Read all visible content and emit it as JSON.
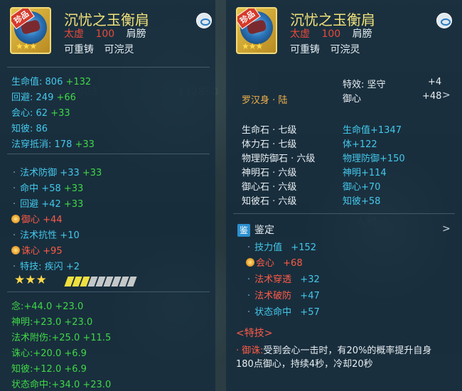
{
  "left": {
    "item": {
      "badge": "珍品",
      "name": "沉忧之玉衡肩",
      "tier": "太虚",
      "level": "100",
      "slot": "肩膀",
      "flags": [
        "可重铸",
        "可浣灵"
      ],
      "stars": "★★★"
    },
    "base_stats": [
      {
        "label": "生命值:",
        "value": "806",
        "bonus": "+132"
      },
      {
        "label": "回避:",
        "value": "249",
        "bonus": "+66"
      },
      {
        "label": "会心:",
        "value": "62",
        "bonus": "+33"
      },
      {
        "label": "知彼:",
        "value": "86",
        "bonus": ""
      },
      {
        "label": "法穿抵消:",
        "value": "178",
        "bonus": "+33"
      }
    ],
    "affixes": [
      {
        "label": "法术防御",
        "value": "+33",
        "bonus": "+33",
        "special": false
      },
      {
        "label": "命中",
        "value": "+58",
        "bonus": "+33",
        "special": false
      },
      {
        "label": "回避",
        "value": "+42",
        "bonus": "+33",
        "special": false
      },
      {
        "label": "御心",
        "value": "+44",
        "bonus": "",
        "special": true
      },
      {
        "label": "法术抗性",
        "value": "+10",
        "bonus": "",
        "special": false
      },
      {
        "label": "诛心",
        "value": "+95",
        "bonus": "",
        "special": true
      },
      {
        "label": "特技:",
        "value": "疾闪",
        "bonus": "+2",
        "special": false
      }
    ],
    "rating_stars": "★★★",
    "enhance_level": 0.33,
    "attrs": [
      {
        "label": "念:",
        "value": "+44.0",
        "bonus": "+23.0"
      },
      {
        "label": "神明:",
        "value": "+23.0",
        "bonus": "+23.0"
      },
      {
        "label": "法术附伤:",
        "value": "+25.0",
        "bonus": "+11.5"
      },
      {
        "label": "诛心:",
        "value": "+20.0",
        "bonus": "+6.9"
      },
      {
        "label": "知彼:",
        "value": "+12.0",
        "bonus": "+6.9"
      },
      {
        "label": "状态命中:",
        "value": "+34.0",
        "bonus": "+23.0"
      }
    ]
  },
  "right": {
    "item": {
      "badge": "珍品",
      "name": "沉忧之玉衡肩",
      "tier": "太虚",
      "level": "100",
      "slot": "肩膀",
      "flags": [
        "可重铸",
        "可浣灵"
      ],
      "stars": "★★★"
    },
    "effect": {
      "label": "特效: 坚守",
      "value": "+4"
    },
    "yuxin": {
      "label": "御心",
      "value": "+48",
      "chevron": ">"
    },
    "set_name": "罗汉身 · 陆",
    "gems": [
      {
        "name": "生命石 · 七级",
        "effect": "生命值+1347"
      },
      {
        "name": "体力石 · 七级",
        "effect": "体+122"
      },
      {
        "name": "物理防御石 · 六级",
        "effect": "物理防御+150"
      },
      {
        "name": "神明石 · 六级",
        "effect": "神明+114"
      },
      {
        "name": "御心石 · 六级",
        "effect": "御心+70"
      },
      {
        "name": "知彼石 · 六级",
        "effect": "知彼+58"
      }
    ],
    "appraise": {
      "icon": "鉴",
      "title": "鉴定",
      "chevron": ">"
    },
    "appraise_stats": [
      {
        "label": "技力值",
        "value": "+152",
        "special": false
      },
      {
        "label": "会心",
        "value": "+68",
        "special": true
      },
      {
        "label": "法术穿透",
        "value": "+32",
        "special": false
      },
      {
        "label": "法术破防",
        "value": "+47",
        "special": false
      },
      {
        "label": "状态命中",
        "value": "+57",
        "special": false
      }
    ],
    "skill_header": "<特技>",
    "skill": {
      "name": "御诛:",
      "desc": "受到会心一击时，有20%的概率提升自身180点御心，持续4秒，冷却20秒"
    }
  },
  "colors": {
    "panel": "#162c3c",
    "stat_cyan": "#44c8ec",
    "bonus_green": "#3fd846",
    "special_red": "#ff5a46",
    "title_yellow": "#f2e27a"
  }
}
